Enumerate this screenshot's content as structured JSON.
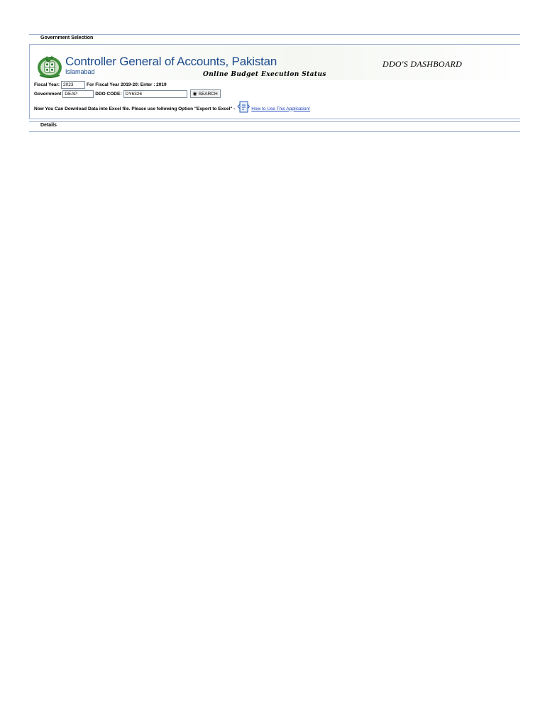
{
  "selection_section": {
    "label": "Government Selection"
  },
  "header": {
    "org_name": "Controller General of Accounts, Pakistan",
    "org_city": "Islamabad",
    "tagline": "Online Budget Execution Status",
    "dashboard_title": "DDO'S DASHBOARD"
  },
  "form": {
    "fiscal_year_label": "Fiscal Year:",
    "fiscal_year_value": "2023",
    "fiscal_year_hint": "For Fiscal Year 2019-20: Enter : 2019",
    "government_label": "Government",
    "government_value": "DEAP",
    "ddo_code_label": "DDO CODE:",
    "ddo_code_value": "DY6326",
    "search_label": "SEARCH",
    "download_note": "Now You Can Download Data into Excel file. Please use following Option \"Export to Excel\" -",
    "help_link": "How to Use This Application!"
  },
  "details_section": {
    "label": "Details"
  },
  "colors": {
    "brand_blue": "#1c4a8c",
    "border": "#9db3cf",
    "link": "#1a3fb8",
    "emblem_green": "#2f7a2f"
  },
  "icons": {
    "emblem": "pakistan-emblem-icon",
    "search": "binoculars-icon",
    "help": "help-document-icon"
  }
}
